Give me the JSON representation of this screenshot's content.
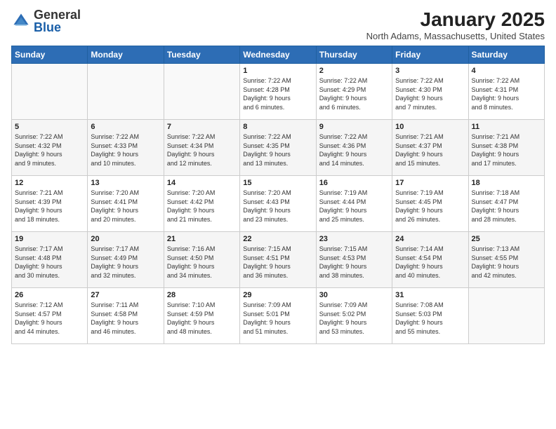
{
  "logo": {
    "general": "General",
    "blue": "Blue"
  },
  "title": "January 2025",
  "location": "North Adams, Massachusetts, United States",
  "days_of_week": [
    "Sunday",
    "Monday",
    "Tuesday",
    "Wednesday",
    "Thursday",
    "Friday",
    "Saturday"
  ],
  "weeks": [
    [
      {
        "day": "",
        "info": ""
      },
      {
        "day": "",
        "info": ""
      },
      {
        "day": "",
        "info": ""
      },
      {
        "day": "1",
        "info": "Sunrise: 7:22 AM\nSunset: 4:28 PM\nDaylight: 9 hours\nand 6 minutes."
      },
      {
        "day": "2",
        "info": "Sunrise: 7:22 AM\nSunset: 4:29 PM\nDaylight: 9 hours\nand 6 minutes."
      },
      {
        "day": "3",
        "info": "Sunrise: 7:22 AM\nSunset: 4:30 PM\nDaylight: 9 hours\nand 7 minutes."
      },
      {
        "day": "4",
        "info": "Sunrise: 7:22 AM\nSunset: 4:31 PM\nDaylight: 9 hours\nand 8 minutes."
      }
    ],
    [
      {
        "day": "5",
        "info": "Sunrise: 7:22 AM\nSunset: 4:32 PM\nDaylight: 9 hours\nand 9 minutes."
      },
      {
        "day": "6",
        "info": "Sunrise: 7:22 AM\nSunset: 4:33 PM\nDaylight: 9 hours\nand 10 minutes."
      },
      {
        "day": "7",
        "info": "Sunrise: 7:22 AM\nSunset: 4:34 PM\nDaylight: 9 hours\nand 12 minutes."
      },
      {
        "day": "8",
        "info": "Sunrise: 7:22 AM\nSunset: 4:35 PM\nDaylight: 9 hours\nand 13 minutes."
      },
      {
        "day": "9",
        "info": "Sunrise: 7:22 AM\nSunset: 4:36 PM\nDaylight: 9 hours\nand 14 minutes."
      },
      {
        "day": "10",
        "info": "Sunrise: 7:21 AM\nSunset: 4:37 PM\nDaylight: 9 hours\nand 15 minutes."
      },
      {
        "day": "11",
        "info": "Sunrise: 7:21 AM\nSunset: 4:38 PM\nDaylight: 9 hours\nand 17 minutes."
      }
    ],
    [
      {
        "day": "12",
        "info": "Sunrise: 7:21 AM\nSunset: 4:39 PM\nDaylight: 9 hours\nand 18 minutes."
      },
      {
        "day": "13",
        "info": "Sunrise: 7:20 AM\nSunset: 4:41 PM\nDaylight: 9 hours\nand 20 minutes."
      },
      {
        "day": "14",
        "info": "Sunrise: 7:20 AM\nSunset: 4:42 PM\nDaylight: 9 hours\nand 21 minutes."
      },
      {
        "day": "15",
        "info": "Sunrise: 7:20 AM\nSunset: 4:43 PM\nDaylight: 9 hours\nand 23 minutes."
      },
      {
        "day": "16",
        "info": "Sunrise: 7:19 AM\nSunset: 4:44 PM\nDaylight: 9 hours\nand 25 minutes."
      },
      {
        "day": "17",
        "info": "Sunrise: 7:19 AM\nSunset: 4:45 PM\nDaylight: 9 hours\nand 26 minutes."
      },
      {
        "day": "18",
        "info": "Sunrise: 7:18 AM\nSunset: 4:47 PM\nDaylight: 9 hours\nand 28 minutes."
      }
    ],
    [
      {
        "day": "19",
        "info": "Sunrise: 7:17 AM\nSunset: 4:48 PM\nDaylight: 9 hours\nand 30 minutes."
      },
      {
        "day": "20",
        "info": "Sunrise: 7:17 AM\nSunset: 4:49 PM\nDaylight: 9 hours\nand 32 minutes."
      },
      {
        "day": "21",
        "info": "Sunrise: 7:16 AM\nSunset: 4:50 PM\nDaylight: 9 hours\nand 34 minutes."
      },
      {
        "day": "22",
        "info": "Sunrise: 7:15 AM\nSunset: 4:51 PM\nDaylight: 9 hours\nand 36 minutes."
      },
      {
        "day": "23",
        "info": "Sunrise: 7:15 AM\nSunset: 4:53 PM\nDaylight: 9 hours\nand 38 minutes."
      },
      {
        "day": "24",
        "info": "Sunrise: 7:14 AM\nSunset: 4:54 PM\nDaylight: 9 hours\nand 40 minutes."
      },
      {
        "day": "25",
        "info": "Sunrise: 7:13 AM\nSunset: 4:55 PM\nDaylight: 9 hours\nand 42 minutes."
      }
    ],
    [
      {
        "day": "26",
        "info": "Sunrise: 7:12 AM\nSunset: 4:57 PM\nDaylight: 9 hours\nand 44 minutes."
      },
      {
        "day": "27",
        "info": "Sunrise: 7:11 AM\nSunset: 4:58 PM\nDaylight: 9 hours\nand 46 minutes."
      },
      {
        "day": "28",
        "info": "Sunrise: 7:10 AM\nSunset: 4:59 PM\nDaylight: 9 hours\nand 48 minutes."
      },
      {
        "day": "29",
        "info": "Sunrise: 7:09 AM\nSunset: 5:01 PM\nDaylight: 9 hours\nand 51 minutes."
      },
      {
        "day": "30",
        "info": "Sunrise: 7:09 AM\nSunset: 5:02 PM\nDaylight: 9 hours\nand 53 minutes."
      },
      {
        "day": "31",
        "info": "Sunrise: 7:08 AM\nSunset: 5:03 PM\nDaylight: 9 hours\nand 55 minutes."
      },
      {
        "day": "",
        "info": ""
      }
    ]
  ]
}
